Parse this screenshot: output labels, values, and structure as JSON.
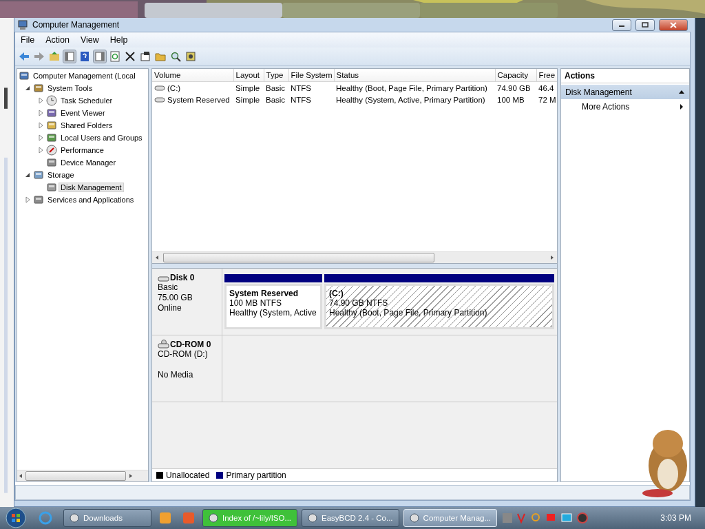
{
  "window": {
    "title": "Computer Management"
  },
  "menu": [
    "File",
    "Action",
    "View",
    "Help"
  ],
  "tree": {
    "label": "Computer Management (Local",
    "selected": false,
    "children": [
      {
        "label": "System Tools",
        "expanded": true,
        "selected": false,
        "children": [
          {
            "label": "Task Scheduler",
            "expanded": false,
            "selected": false
          },
          {
            "label": "Event Viewer",
            "expanded": false,
            "selected": false
          },
          {
            "label": "Shared Folders",
            "expanded": false,
            "selected": false
          },
          {
            "label": "Local Users and Groups",
            "expanded": false,
            "selected": false
          },
          {
            "label": "Performance",
            "expanded": false,
            "selected": false
          },
          {
            "label": "Device Manager",
            "selected": false
          }
        ]
      },
      {
        "label": "Storage",
        "expanded": true,
        "selected": false,
        "children": [
          {
            "label": "Disk Management",
            "selected": true
          }
        ]
      },
      {
        "label": "Services and Applications",
        "expanded": false,
        "selected": false
      }
    ]
  },
  "table": {
    "columns": [
      "Volume",
      "Layout",
      "Type",
      "File System",
      "Status",
      "Capacity",
      "Free"
    ],
    "rows": [
      {
        "cells": [
          "(C:)",
          "Simple",
          "Basic",
          "NTFS",
          "Healthy (Boot, Page File, Primary Partition)",
          "74.90 GB",
          "46.4"
        ]
      },
      {
        "cells": [
          "System Reserved",
          "Simple",
          "Basic",
          "NTFS",
          "Healthy (System, Active, Primary Partition)",
          "100 MB",
          "72 M"
        ]
      }
    ]
  },
  "disks": [
    {
      "kind": "disk",
      "name": "Disk 0",
      "lines": [
        "Basic",
        "75.00 GB",
        "Online"
      ],
      "partitions": [
        {
          "name": "System Reserved",
          "size": "100 MB NTFS",
          "status": "Healthy (System, Active",
          "hatched": false
        },
        {
          "name": "(C:)",
          "size": "74.90 GB NTFS",
          "status": "Healthy (Boot, Page File, Primary Partition)",
          "hatched": true
        }
      ]
    },
    {
      "kind": "cdrom",
      "name": "CD-ROM 0",
      "lines": [
        "CD-ROM (D:)",
        "No Media"
      ]
    }
  ],
  "legend": [
    {
      "label": "Unallocated",
      "color": "#000000"
    },
    {
      "label": "Primary partition",
      "color": "#000080"
    }
  ],
  "actions": {
    "title": "Actions",
    "sections": [
      {
        "title": "Disk Management",
        "expanded": true,
        "items": [
          "More Actions"
        ]
      }
    ]
  },
  "taskbar": {
    "items": [
      {
        "kind": "button",
        "label": "Downloads",
        "active": false
      },
      {
        "kind": "icon"
      },
      {
        "kind": "icon"
      },
      {
        "kind": "button",
        "label": "Index of /~lily/ISO...",
        "active": false,
        "color": "#3fc13a"
      },
      {
        "kind": "button",
        "label": "EasyBCD 2.4 - Co...",
        "active": false
      },
      {
        "kind": "button",
        "label": "Computer Manag...",
        "active": true
      }
    ],
    "clock": "3:03 PM"
  }
}
